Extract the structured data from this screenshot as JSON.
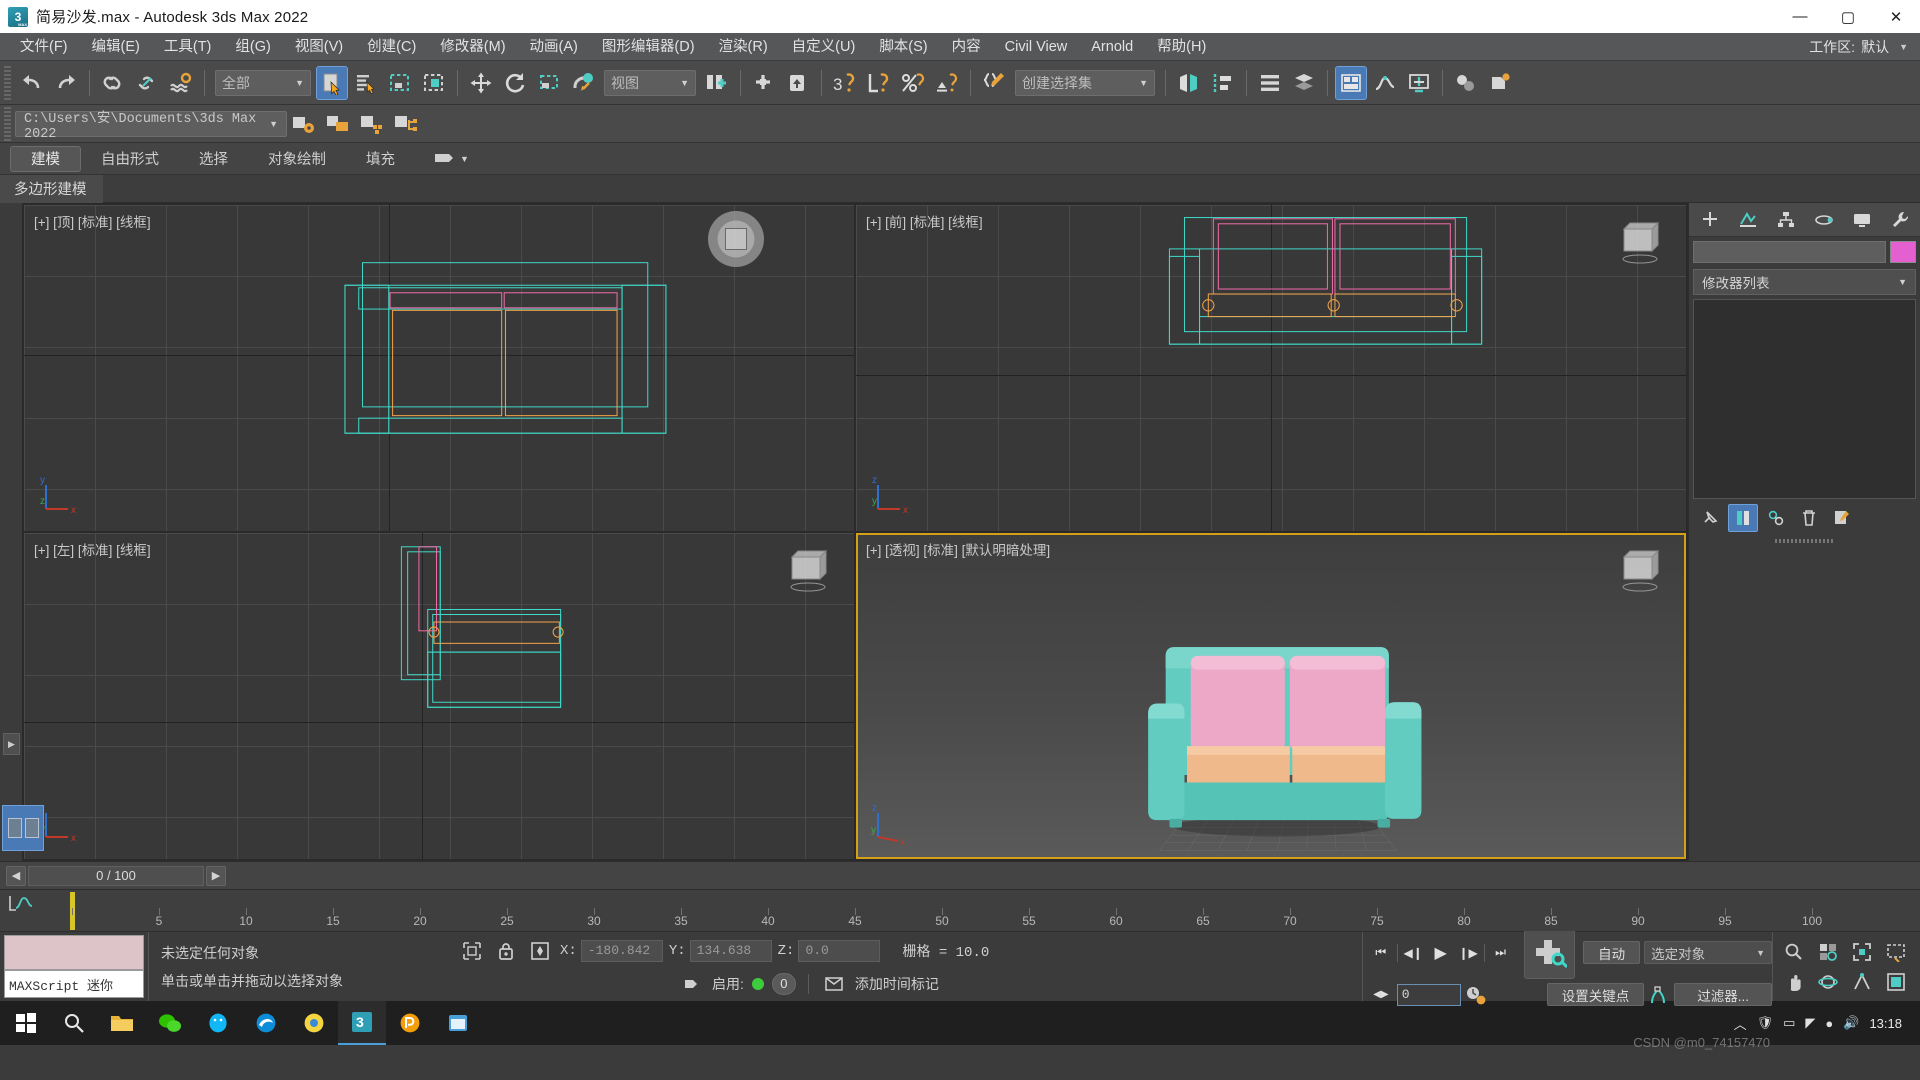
{
  "titlebar": {
    "title": "简易沙发.max - Autodesk 3ds Max 2022",
    "app_icon": "3dsmax-icon",
    "minimize": "—",
    "maximize": "▢",
    "close": "✕"
  },
  "menubar": {
    "items": [
      {
        "label": "文件(F)"
      },
      {
        "label": "编辑(E)"
      },
      {
        "label": "工具(T)"
      },
      {
        "label": "组(G)"
      },
      {
        "label": "视图(V)"
      },
      {
        "label": "创建(C)"
      },
      {
        "label": "修改器(M)"
      },
      {
        "label": "动画(A)"
      },
      {
        "label": "图形编辑器(D)"
      },
      {
        "label": "渲染(R)"
      },
      {
        "label": "自定义(U)"
      },
      {
        "label": "脚本(S)"
      },
      {
        "label": "内容"
      },
      {
        "label": "Civil View"
      },
      {
        "label": "Arnold"
      },
      {
        "label": "帮助(H)"
      }
    ],
    "workspace_label": "工作区:",
    "workspace_value": "默认",
    "workspace_arrow": "▼",
    "overflow_arrow": "▾"
  },
  "toolbar": {
    "undo": "undo-icon",
    "redo": "redo-icon",
    "select_and_link": "select-and-link-icon",
    "unlink": "unlink-selection-icon",
    "bind_space_warp": "bind-to-space-warp-icon",
    "selection_filter_value": "全部",
    "selection_filter_arrow": "▼",
    "select_object": "select-object-icon",
    "select_by_name": "select-by-name-icon",
    "rect_select_region": "rectangular-selection-region-icon",
    "window_crossing": "window-crossing-icon",
    "select_and_move": "select-and-move-icon",
    "select_and_rotate": "select-and-rotate-icon",
    "select_and_scale": "select-and-scale-icon",
    "select_and_place": "select-and-place-icon",
    "ref_coord_value": "视图",
    "ref_coord_arrow": "▼",
    "use_pivot_center": "use-pivot-point-center-icon",
    "select_and_manipulate": "select-and-manipulate-icon",
    "snaps_toggle_3": "snaps-toggle-icon",
    "angle_snap": "angle-snap-toggle-icon",
    "percent_snap": "percent-snap-toggle-icon",
    "spinner_snap": "spinner-snap-toggle-icon",
    "edit_named_sets": "edit-named-selection-sets-icon",
    "named_set_value": "创建选择集",
    "named_set_arrow": "▼",
    "mirror": "mirror-icon",
    "align": "align-icon",
    "layer_explorer": "layer-explorer-icon",
    "scene_explorer": "scene-explorer-icon",
    "ribbon_toggle": "toggle-ribbon-icon",
    "curve_editor": "curve-editor-icon",
    "schematic_view": "schematic-view-icon",
    "material_editor": "material-editor-icon",
    "render_setup": "render-setup-icon"
  },
  "pathrow": {
    "project_path": "C:\\Users\\安\\Documents\\3ds Max 2022",
    "path_arrow": "▼",
    "project_settings": "project-settings-icon",
    "open_folder": "open-project-folder-icon",
    "add_asset": "add-asset-icon",
    "manage_assets": "manage-assets-icon"
  },
  "ribbon": {
    "tabs": [
      {
        "label": "建模",
        "selected": true
      },
      {
        "label": "自由形式",
        "selected": false
      },
      {
        "label": "选择",
        "selected": false
      },
      {
        "label": "对象绘制",
        "selected": false
      },
      {
        "label": "填充",
        "selected": false
      }
    ],
    "overflow_icon": "ribbon-overflow-icon",
    "overflow_arrow": "▼",
    "panel_label": "多边形建模"
  },
  "viewports": [
    {
      "label": "[+] [顶] [标准] [线框]",
      "name": "top",
      "active": false
    },
    {
      "label": "[+] [前] [标准] [线框]",
      "name": "front",
      "active": false
    },
    {
      "label": "[+] [左] [标准] [线框]",
      "name": "left",
      "active": false
    },
    {
      "label": "[+] [透视] [标准] [默认明暗处理]",
      "name": "perspective",
      "active": true
    }
  ],
  "gizmo_axes": {
    "x": "x",
    "y": "y",
    "z": "z"
  },
  "command_panel": {
    "tabs": [
      {
        "name": "create-tab",
        "icon": "plus-icon",
        "selected": false
      },
      {
        "name": "modify-tab",
        "icon": "modify-icon",
        "selected": false
      },
      {
        "name": "hierarchy-tab",
        "icon": "hierarchy-icon",
        "selected": false
      },
      {
        "name": "motion-tab",
        "icon": "motion-icon",
        "selected": false
      },
      {
        "name": "display-tab",
        "icon": "display-icon",
        "selected": false
      },
      {
        "name": "utilities-tab",
        "icon": "wrench-icon",
        "selected": false
      }
    ],
    "object_name": "",
    "object_color": "#e45fd0",
    "modifier_list_label": "修改器列表",
    "modifier_list_arrow": "▼",
    "stack_buttons": [
      {
        "name": "pin-stack-button",
        "icon": "pin-icon",
        "selected": false
      },
      {
        "name": "show-end-result-button",
        "icon": "show-end-result-icon",
        "selected": true
      },
      {
        "name": "make-unique-button",
        "icon": "make-unique-icon",
        "selected": false
      },
      {
        "name": "remove-modifier-button",
        "icon": "trash-icon",
        "selected": false
      },
      {
        "name": "configure-sets-button",
        "icon": "configure-modifier-sets-icon",
        "selected": false
      }
    ]
  },
  "timeslider": {
    "prev_arrow": "◀",
    "next_arrow": "▶",
    "value": "0 / 100"
  },
  "trackbar": {
    "curve_editor_icon": "mini-curve-editor-icon",
    "ticks": [
      0,
      5,
      10,
      15,
      20,
      25,
      30,
      35,
      40,
      45,
      50,
      55,
      60,
      65,
      70,
      75,
      80,
      85,
      90,
      95,
      100
    ],
    "playhead_frame": 0
  },
  "statusbar": {
    "maxscript_label": "MAXScript 迷你",
    "message_selection": "未选定任何对象",
    "message_prompt": "单击或单击并拖动以选择对象",
    "isolate_icon": "isolate-selection-icon",
    "lock_icon": "selection-lock-icon",
    "abs_rel_icon": "absolute-relative-transform-icon",
    "coords": [
      {
        "axis": "X:",
        "value": "-180.842"
      },
      {
        "axis": "Y:",
        "value": "134.638"
      },
      {
        "axis": "Z:",
        "value": "0.0"
      }
    ],
    "grid_label": "栅格 = 10.0",
    "key_mode_icon": "key-mode-icon",
    "enable_label": "启用:",
    "enable_state": "on",
    "key_count": "0",
    "add_time_tag_icon": "add-time-tag-icon",
    "add_time_tag_label": "添加时间标记"
  },
  "animation": {
    "go_to_start": "⏮",
    "prev_frame": "◀❙",
    "play": "▶",
    "next_frame": "❙▶",
    "go_to_end": "⏭",
    "key_step_prev": "◀",
    "key_step_next": "▶",
    "frame_value": "0",
    "time_config_icon": "time-configuration-icon",
    "set_key_icon": "set-key-icon",
    "auto_key_label": "自动",
    "set_key_label": "设置关键点",
    "key_filters_label": "过滤器...",
    "selection_list_value": "选定对象",
    "selection_list_arrow": "▼",
    "key_filter_icon": "key-filters-icon"
  },
  "navigation": {
    "zoom": "zoom-icon",
    "zoom_all": "zoom-all-icon",
    "zoom_extents": "zoom-extents-icon",
    "zoom_region": "zoom-region-icon",
    "pan": "pan-hand-icon",
    "orbit": "orbit-icon",
    "maximize_viewport": "maximize-viewport-toggle-icon",
    "field_of_view": "field-of-view-icon"
  },
  "taskbar": {
    "start": "start-icon",
    "search": "search-icon",
    "items": [
      {
        "name": "file-explorer-icon",
        "color": "#e8b339"
      },
      {
        "name": "wechat-icon",
        "color": "#2dc100"
      },
      {
        "name": "qq-icon",
        "color": "#12b7f5"
      },
      {
        "name": "edge-icon",
        "color": "#0f8cd8"
      },
      {
        "name": "browser-icon",
        "color": "#f5d442"
      },
      {
        "name": "3dsmax-icon",
        "color": "#2f9fb5",
        "running": true
      },
      {
        "name": "photoshop-icon",
        "color": "#f59e0b"
      },
      {
        "name": "window-app-icon",
        "color": "#4a9fd8"
      }
    ],
    "tray": [
      {
        "name": "chevron-up-icon",
        "glyph": "︿"
      },
      {
        "name": "security-icon",
        "glyph": "🛡"
      },
      {
        "name": "monitor-icon",
        "glyph": "▭"
      },
      {
        "name": "network-icon",
        "glyph": "◤"
      },
      {
        "name": "penguin-icon",
        "glyph": "●"
      },
      {
        "name": "volume-icon",
        "glyph": "🔊"
      }
    ],
    "clock_time": "13:18",
    "watermark": "CSDN @m0_74157470"
  },
  "colors": {
    "accent_teal": "#4ecdc4",
    "accent_pink": "#e86ca8",
    "accent_orange": "#e8913a",
    "sofa_body": "#5cc9bd",
    "sofa_cushion": "#eeb98a",
    "sofa_back": "#eda8c8",
    "highlight_blue": "#4a7ab5",
    "active_viewport": "#d4a017"
  }
}
